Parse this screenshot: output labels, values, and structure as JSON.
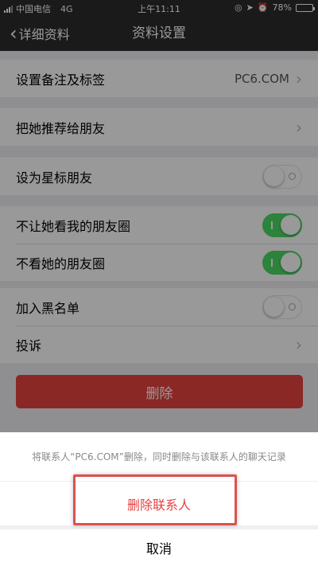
{
  "status_bar": {
    "carrier": "中国电信",
    "network": "4G",
    "time": "上午11:11",
    "battery_text": "78%",
    "battery_level": 0.78
  },
  "nav": {
    "back_label": "详细资料",
    "title": "资料设置"
  },
  "settings": {
    "remark_tag": {
      "label": "设置备注及标签",
      "value": "PC6.COM"
    },
    "recommend": {
      "label": "把她推荐给朋友"
    },
    "star_friend": {
      "label": "设为星标朋友",
      "on": false
    },
    "hide_my_moments": {
      "label": "不让她看我的朋友圈",
      "on": true
    },
    "hide_her_moments": {
      "label": "不看她的朋友圈",
      "on": true
    },
    "blacklist": {
      "label": "加入黑名单",
      "on": false
    },
    "report": {
      "label": "投诉"
    }
  },
  "delete_button": "删除",
  "action_sheet": {
    "message": "将联系人“PC6.COM”删除，同时删除与该联系人的聊天记录",
    "confirm": "删除联系人",
    "cancel": "取消"
  },
  "colors": {
    "nav_bg": "#2c2c2c",
    "danger": "#e64340",
    "toggle_on": "#4cd964",
    "highlight_box": "#d9534f"
  }
}
